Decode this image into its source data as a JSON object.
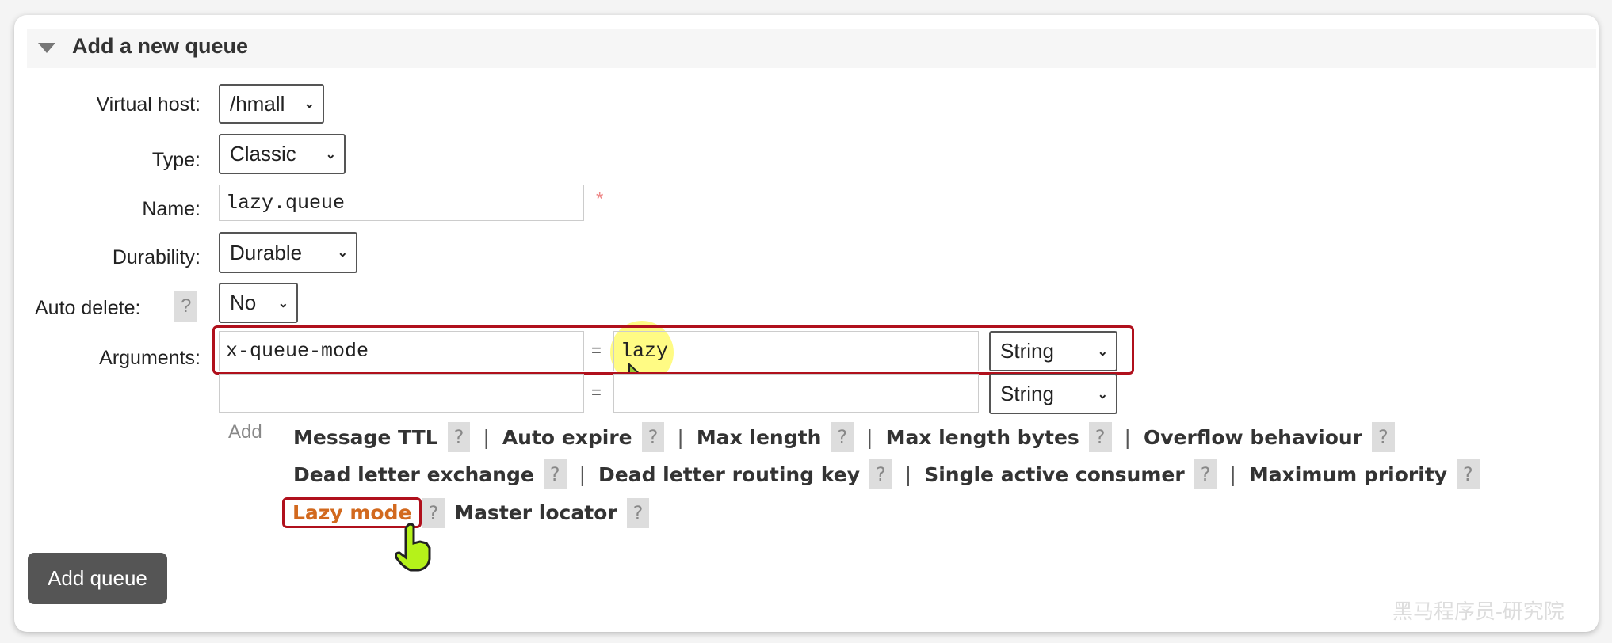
{
  "section": {
    "title": "Add a new queue",
    "collapse_icon": "triangle-down-icon"
  },
  "form": {
    "virtual_host": {
      "label": "Virtual host:",
      "value": "/hmall"
    },
    "type": {
      "label": "Type:",
      "value": "Classic"
    },
    "name": {
      "label": "Name:",
      "value": "lazy.queue",
      "required_mark": "*"
    },
    "durability": {
      "label": "Durability:",
      "value": "Durable"
    },
    "auto_delete": {
      "label": "Auto delete:",
      "help": "?",
      "value": "No"
    },
    "arguments": {
      "label": "Arguments:",
      "rows": [
        {
          "key": "x-queue-mode",
          "eq": "=",
          "value": "lazy",
          "type": "String"
        },
        {
          "key": "",
          "eq": "=",
          "value": "",
          "type": "String"
        }
      ]
    }
  },
  "add_label": "Add",
  "shortcuts": [
    [
      {
        "label": "Message TTL",
        "help": "?"
      },
      {
        "label": "Auto expire",
        "help": "?"
      },
      {
        "label": "Max length",
        "help": "?"
      },
      {
        "label": "Max length bytes",
        "help": "?"
      },
      {
        "label": "Overflow behaviour",
        "help": "?"
      }
    ],
    [
      {
        "label": "Dead letter exchange",
        "help": "?"
      },
      {
        "label": "Dead letter routing key",
        "help": "?"
      },
      {
        "label": "Single active consumer",
        "help": "?"
      },
      {
        "label": "Maximum priority",
        "help": "?"
      }
    ],
    [
      {
        "label": "Lazy mode",
        "help": "?",
        "highlighted": true
      },
      {
        "label": "Master locator",
        "help": "?"
      }
    ]
  ],
  "separator": "|",
  "submit": {
    "label": "Add queue"
  },
  "watermark": "黑马程序员-研究院",
  "colors": {
    "highlight": "#b0101c",
    "lazy_link": "#d2691e",
    "button": "#555555"
  }
}
